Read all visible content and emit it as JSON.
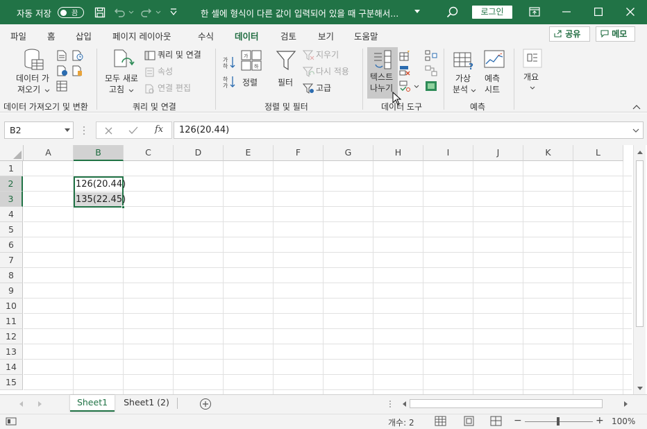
{
  "titlebar": {
    "autosave_label": "자동 저장",
    "autosave_state": "끔",
    "doc_title": "한 셀에 형식이 다른 값이 입력되어 있을 때 구분해서...",
    "login_label": "로그인",
    "quick_access_icons": [
      "save-icon",
      "undo-icon",
      "redo-icon",
      "customize-icon"
    ],
    "window_icons": [
      "search-icon",
      "ribbon-display-icon",
      "minimize-icon",
      "maximize-icon",
      "close-icon"
    ]
  },
  "menu": {
    "tabs": [
      "파일",
      "홈",
      "삽입",
      "페이지 레이아웃",
      "수식",
      "데이터",
      "검토",
      "보기",
      "도움말"
    ],
    "active_tab": "데이터",
    "share_label": "공유",
    "memo_label": "메모"
  },
  "ribbon": {
    "get_data": {
      "label1": "데이터 가",
      "label2": "져오기",
      "group": "데이터 가져오기 및 변환"
    },
    "refresh_all": {
      "label1": "모두 새로",
      "label2": "고침"
    },
    "queries": {
      "queries_connections": "쿼리 및 연결",
      "properties": "속성",
      "edit_links": "연결 편집",
      "group": "쿼리 및 연결"
    },
    "sort": {
      "sort_label": "정렬",
      "filter_label": "필터",
      "clear_label": "지우기",
      "reapply_label": "다시 적용",
      "advanced_label": "고급",
      "group": "정렬 및 필터"
    },
    "data_tools": {
      "text_to_columns1": "텍스트",
      "text_to_columns2": "나누기",
      "group": "데이터 도구"
    },
    "forecast": {
      "whatif1": "가상",
      "whatif2": "분석",
      "sheet1": "예측",
      "sheet2": "시트",
      "group": "예측"
    },
    "outline": {
      "label": "개요"
    }
  },
  "formula_bar": {
    "name_box": "B2",
    "formula": "126(20.44)"
  },
  "grid": {
    "columns": [
      "A",
      "B",
      "C",
      "D",
      "E",
      "F",
      "G",
      "H",
      "I",
      "J",
      "K",
      "L"
    ],
    "rows": [
      "1",
      "2",
      "3",
      "4",
      "5",
      "6",
      "7",
      "8",
      "9",
      "10",
      "11",
      "12",
      "13",
      "14",
      "15"
    ],
    "cells": {
      "B2": "126(20.44)",
      "B3": "135(22.45)"
    },
    "selected_range": "B2:B3",
    "accent": "#217346"
  },
  "sheets": {
    "tabs": [
      "Sheet1",
      "Sheet1 (2)"
    ],
    "active": "Sheet1"
  },
  "status": {
    "count_label": "개수: 2",
    "zoom": "100%"
  },
  "colors": {
    "brand": "#217346",
    "ribbon_bg": "#f3f3f3"
  }
}
